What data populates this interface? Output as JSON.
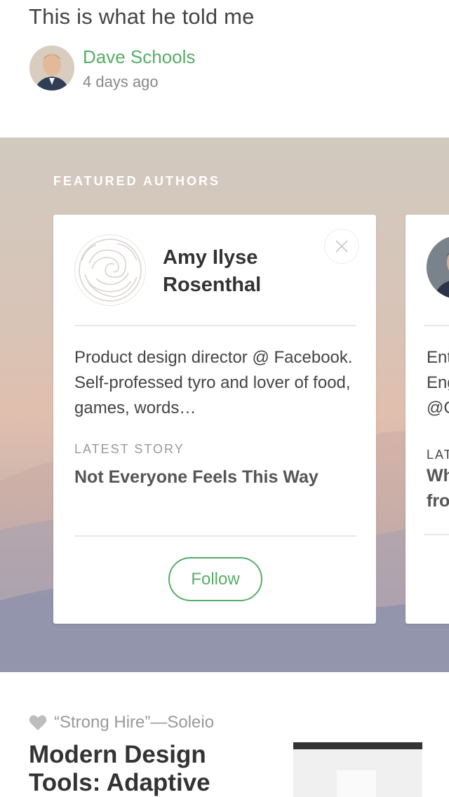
{
  "top_story": {
    "title": "This is what he told me",
    "author_name": "Dave Schools",
    "posted": "4 days ago"
  },
  "featured": {
    "heading": "FEATURED AUTHORS",
    "card": {
      "name": "Amy Ilyse Rosenthal",
      "bio": "Product design director @ Facebook. Self-professed tyro and lover of food, games, words…",
      "latest_label": "LATEST STORY",
      "latest_title": "Not Everyone Feels This Way",
      "follow_label": "Follow",
      "close_icon": "close-icon"
    },
    "next_card": {
      "bio_line1": "Ent",
      "bio_line2": "Eng",
      "bio_line3": "@C",
      "latest_label": "LAT",
      "latest_line1": "Wh",
      "latest_line2": "fro"
    }
  },
  "bottom_story": {
    "recommended_by": "“Strong Hire”—Soleio",
    "title": "Modern Design Tools: Adaptive",
    "icon": "heart-icon"
  },
  "colors": {
    "accent_green": "#57ad68",
    "text_dark": "#333333",
    "text_muted": "#999999"
  }
}
